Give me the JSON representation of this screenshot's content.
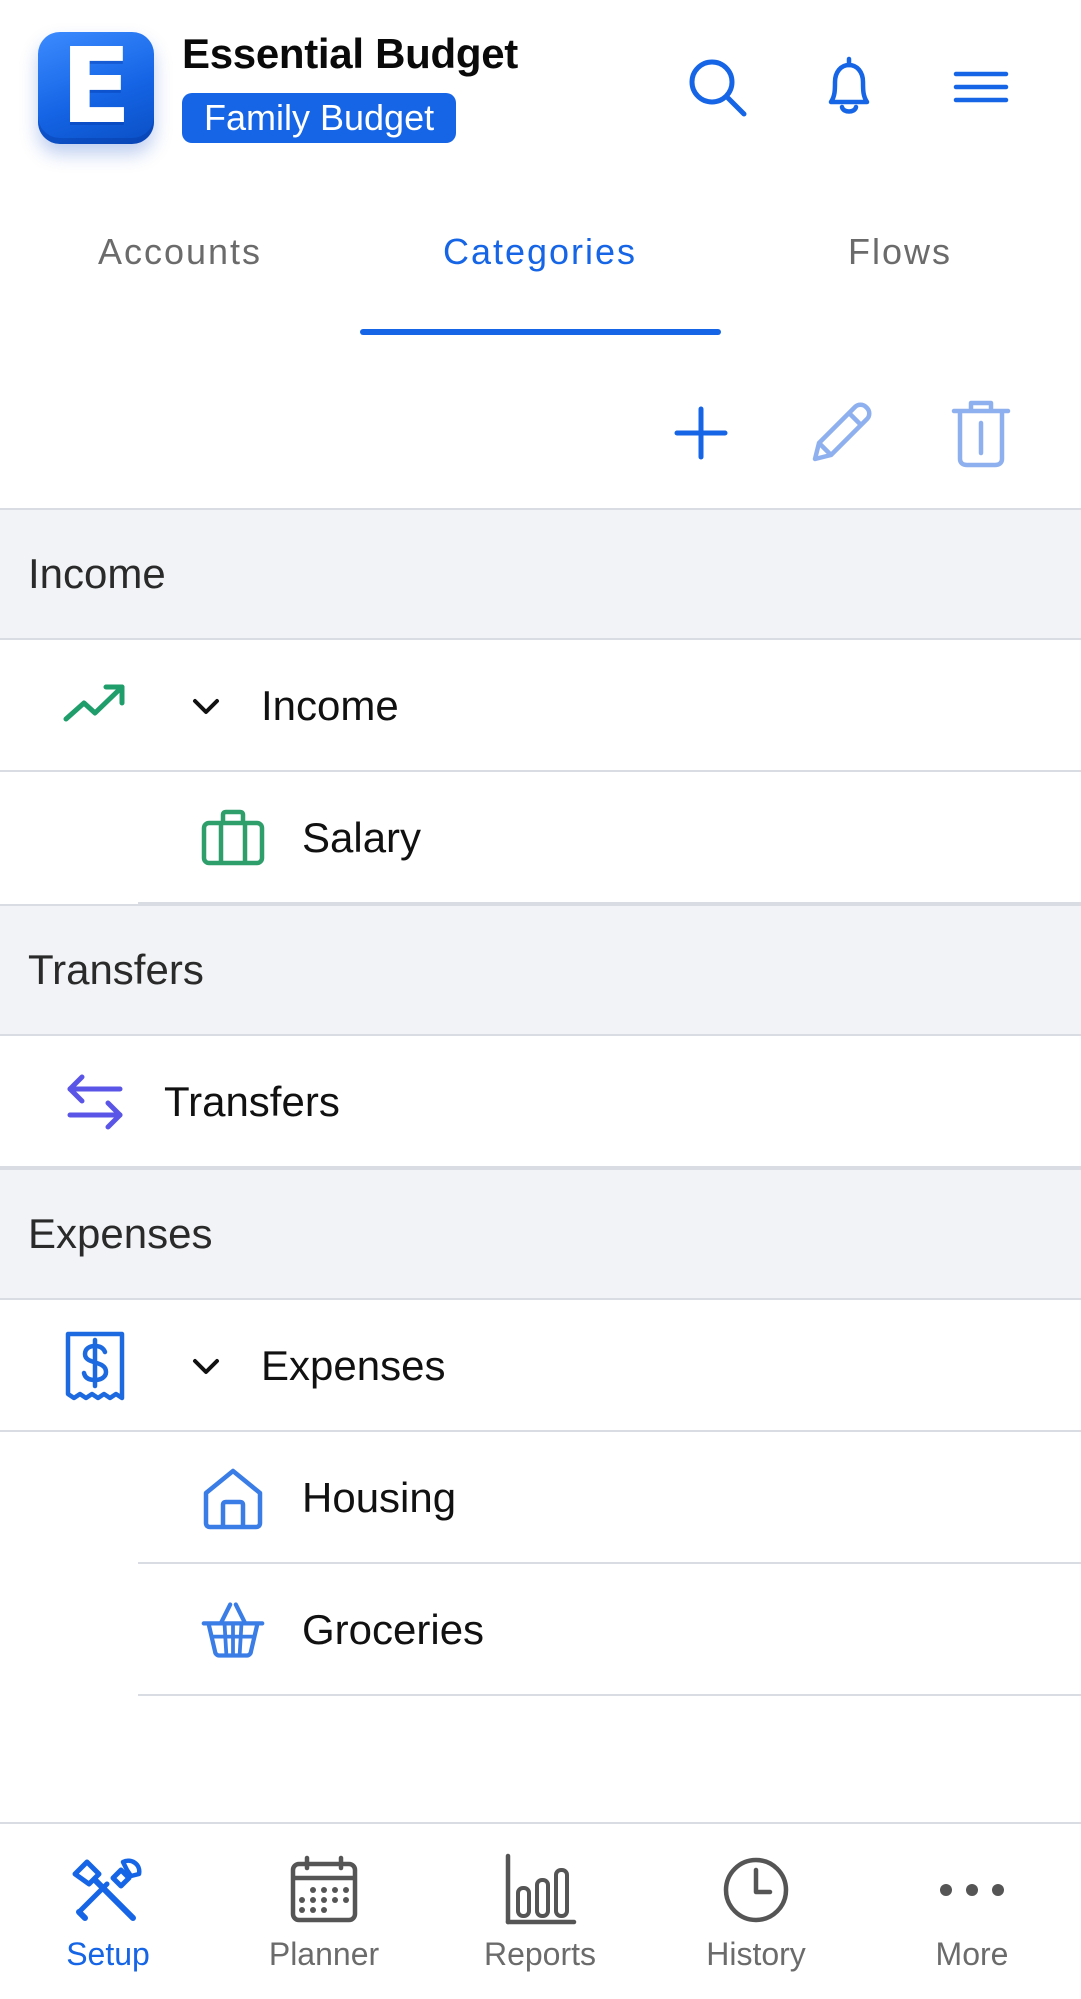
{
  "app": {
    "logo_letter": "E",
    "title": "Essential Budget",
    "budget_name": "Family Budget",
    "accent_color": "#1565e6"
  },
  "header_icons": [
    "search-icon",
    "bell-icon",
    "hamburger-menu-icon"
  ],
  "tabs": [
    {
      "label": "Accounts",
      "active": false
    },
    {
      "label": "Categories",
      "active": true
    },
    {
      "label": "Flows",
      "active": false
    }
  ],
  "toolbar": [
    "add-icon",
    "edit-icon",
    "delete-icon"
  ],
  "sections": [
    {
      "title": "Income",
      "rows": [
        {
          "label": "Income",
          "icon": "trending-up-icon",
          "expandable": true,
          "level": 0,
          "color": "#1f9d6b"
        },
        {
          "label": "Salary",
          "icon": "briefcase-icon",
          "expandable": false,
          "level": 1,
          "color": "#2e9e6a"
        }
      ]
    },
    {
      "title": "Transfers",
      "rows": [
        {
          "label": "Transfers",
          "icon": "transfer-arrows-icon",
          "expandable": false,
          "level": 0,
          "color": "#5a55e6"
        }
      ]
    },
    {
      "title": "Expenses",
      "rows": [
        {
          "label": "Expenses",
          "icon": "receipt-dollar-icon",
          "expandable": true,
          "level": 0,
          "color": "#1d6ae0"
        },
        {
          "label": "Housing",
          "icon": "house-icon",
          "expandable": false,
          "level": 1,
          "color": "#3a7de6"
        },
        {
          "label": "Groceries",
          "icon": "shopping-basket-icon",
          "expandable": false,
          "level": 1,
          "color": "#3a7de6"
        }
      ]
    }
  ],
  "bottom_nav": [
    {
      "label": "Setup",
      "icon": "tools-icon",
      "active": true
    },
    {
      "label": "Planner",
      "icon": "calendar-icon",
      "active": false
    },
    {
      "label": "Reports",
      "icon": "bar-chart-icon",
      "active": false
    },
    {
      "label": "History",
      "icon": "clock-icon",
      "active": false
    },
    {
      "label": "More",
      "icon": "more-dots-icon",
      "active": false
    }
  ]
}
